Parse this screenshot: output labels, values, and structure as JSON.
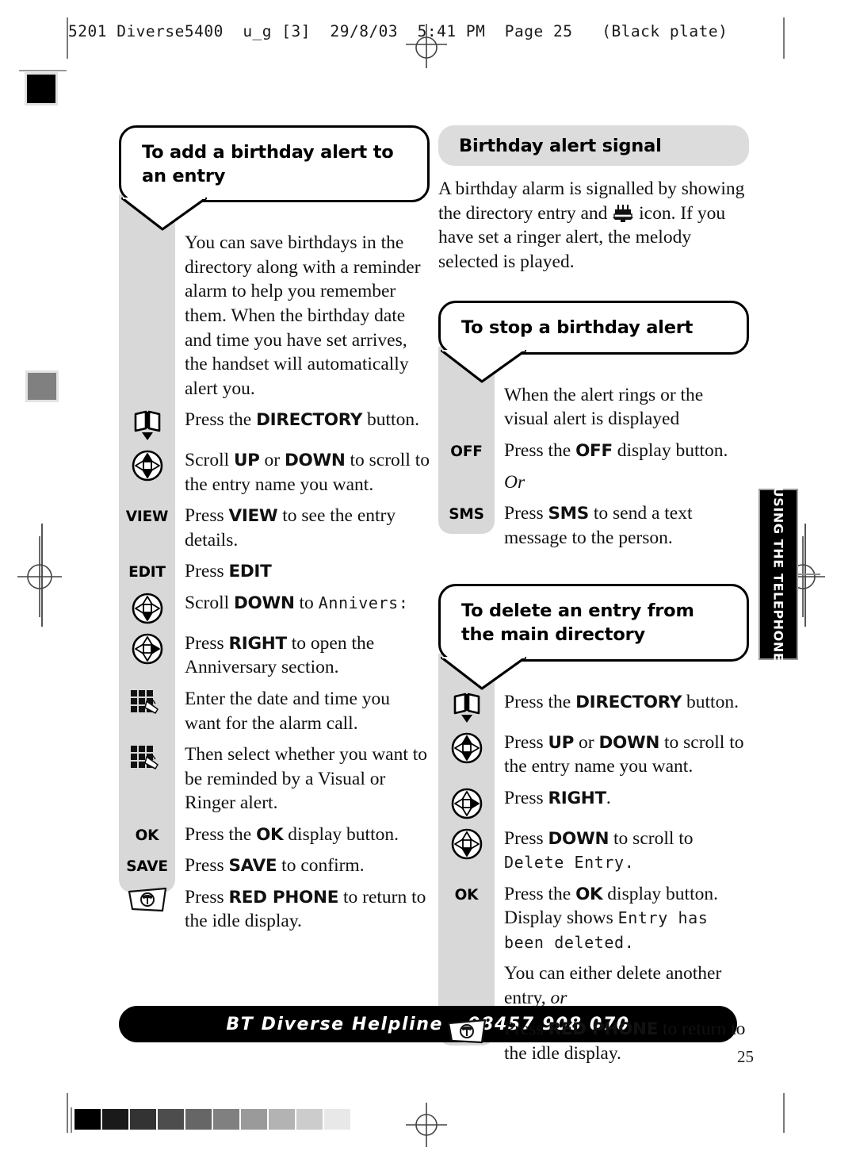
{
  "print_marks": {
    "header_line": "5201 Diverse5400  u_g [3]  29/8/03  5:41 PM  Page 25   (Black plate)",
    "greyscale_bar": [
      "#000000",
      "#1a1a1a",
      "#333333",
      "#4d4d4d",
      "#666666",
      "#808080",
      "#9a9a9a",
      "#b3b3b3",
      "#cccccc",
      "#e8e8e8"
    ]
  },
  "side_tab": {
    "label": "USING THE TELEPHONE"
  },
  "footer": {
    "helpline": "BT Diverse Helpline – 08457 908 070",
    "page_number": "25"
  },
  "left_column": {
    "heading": "To add a birthday alert to an entry",
    "intro": "You can save birthdays in the directory along with a reminder alarm to help you remember them. When the birthday date and time you have set arrives, the handset will automatically alert you.",
    "steps": [
      {
        "cue": "directory-icon",
        "cue_label": "",
        "text": "Press the <b>DIRECTORY</b> button."
      },
      {
        "cue": "dpad-updown-icon",
        "cue_label": "",
        "text": "Scroll <b>UP</b> or <b>DOWN</b> to scroll to the entry name you want."
      },
      {
        "cue": "softkey",
        "cue_label": "VIEW",
        "text": "Press <b>VIEW</b> to see the entry details."
      },
      {
        "cue": "softkey",
        "cue_label": "EDIT",
        "text": "Press <b>EDIT</b>"
      },
      {
        "cue": "dpad-down-icon",
        "cue_label": "",
        "text": "Scroll <b>DOWN</b> to <span class='lcd'>Annivers:</span>"
      },
      {
        "cue": "dpad-right-icon",
        "cue_label": "",
        "text": "Press <b>RIGHT</b> to open the Anniversary section."
      },
      {
        "cue": "keypad-icon",
        "cue_label": "",
        "text": "Enter the date and time you want for the alarm call."
      },
      {
        "cue": "keypad-icon",
        "cue_label": "",
        "text": "Then select whether you want to be reminded by a Visual or Ringer alert."
      },
      {
        "cue": "softkey",
        "cue_label": "OK",
        "text": "Press the <b>OK</b> display button."
      },
      {
        "cue": "softkey",
        "cue_label": "SAVE",
        "text": "Press <b>SAVE</b> to confirm."
      },
      {
        "cue": "red-phone-icon",
        "cue_label": "",
        "text": "Press <b>RED PHONE</b> to return to the idle display."
      }
    ]
  },
  "right_column": {
    "signal_section": {
      "heading": "Birthday alert signal",
      "body_before_icon": "A birthday alarm is signalled by showing the directory entry and ",
      "body_after_icon": " icon. If you have set a ringer alert, the melody selected is played."
    },
    "stop_section": {
      "heading": "To stop a birthday alert",
      "steps": [
        {
          "cue": "none",
          "cue_label": "",
          "text": "When the alert rings or the visual alert is displayed"
        },
        {
          "cue": "softkey",
          "cue_label": "OFF",
          "text": "Press the <b>OFF</b> display button."
        },
        {
          "cue": "none",
          "cue_label": "",
          "text": "<i class='or'>Or</i>"
        },
        {
          "cue": "softkey",
          "cue_label": "SMS",
          "text": "Press <b>SMS</b> to send a text message to the person."
        }
      ]
    },
    "delete_section": {
      "heading": "To delete an entry from the main directory",
      "steps": [
        {
          "cue": "directory-icon",
          "cue_label": "",
          "text": "Press the <b>DIRECTORY</b> button."
        },
        {
          "cue": "dpad-updown-icon",
          "cue_label": "",
          "text": "Press <b>UP</b> or <b>DOWN</b> to scroll to the entry name you want."
        },
        {
          "cue": "dpad-right-icon",
          "cue_label": "",
          "text": "Press <b>RIGHT</b>."
        },
        {
          "cue": "dpad-down-icon",
          "cue_label": "",
          "text": "Press <b>DOWN</b> to scroll to <span class='lcd'>Delete Entry.</span>"
        },
        {
          "cue": "softkey",
          "cue_label": "OK",
          "text": "Press the <b>OK</b> display button. Display shows <span class='lcd'>Entry has been deleted.</span>"
        },
        {
          "cue": "none",
          "cue_label": "",
          "text": "You can either delete another entry, <i class='or'>or</i>"
        },
        {
          "cue": "red-phone-icon",
          "cue_label": "",
          "text": "Press <b>RED PHONE</b> to return to the idle display."
        }
      ]
    }
  }
}
